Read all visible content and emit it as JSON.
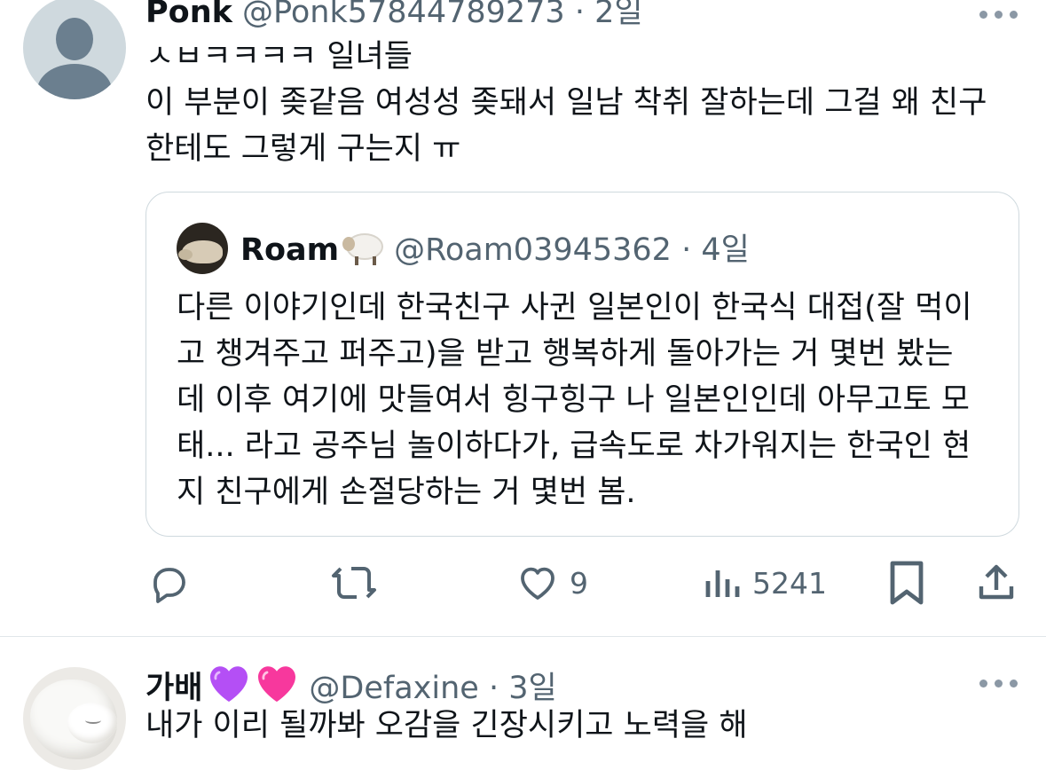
{
  "tweet1": {
    "display_name": "Ponk",
    "handle": "@Ponk57844789273",
    "time": "2일",
    "text_lines": [
      "ㅅㅂㅋㅋㅋㅋ 일녀들",
      "이 부분이 좆같음 여성성 좆돼서 일남 착취 잘하는데 그걸 왜 친구",
      "한테도 그렇게 구는지 ㅠ"
    ],
    "quote": {
      "display_name": "Roam",
      "handle": "@Roam03945362",
      "time": "4일",
      "text_lines": [
        "다른 이야기인데 한국친구 사귄 일본인이 한국식 대접(잘 먹이",
        "고 챙겨주고 퍼주고)을 받고 행복하게 돌아가는 거 몇번 봤는",
        "데 이후 여기에 맛들여서 힝구힝구 나 일본인인데 아무고토 모",
        "태... 라고 공주님 놀이하다가, 급속도로 차가워지는 한국인 현",
        "지 친구에게 손절당하는 거 몇번 봄."
      ]
    },
    "actions": {
      "likes": "9",
      "views": "5241"
    }
  },
  "tweet2": {
    "display_name": "가배",
    "handle": "@Defaxine",
    "time": "3일",
    "text": "내가 이리 될까봐 오감을 긴장시키고 노력을 해"
  },
  "icons": [
    "more-icon",
    "reply-icon",
    "retweet-icon",
    "like-icon",
    "views-icon",
    "bookmark-icon",
    "share-icon",
    "purple-heart-emoji",
    "pink-heart-emoji",
    "sheep-emoji"
  ],
  "colors": {
    "text": "#0f1419",
    "secondary": "#536471",
    "border": "#cfd9de",
    "purple_heart": "#b44ff5",
    "pink_heart": "#f7389d"
  }
}
